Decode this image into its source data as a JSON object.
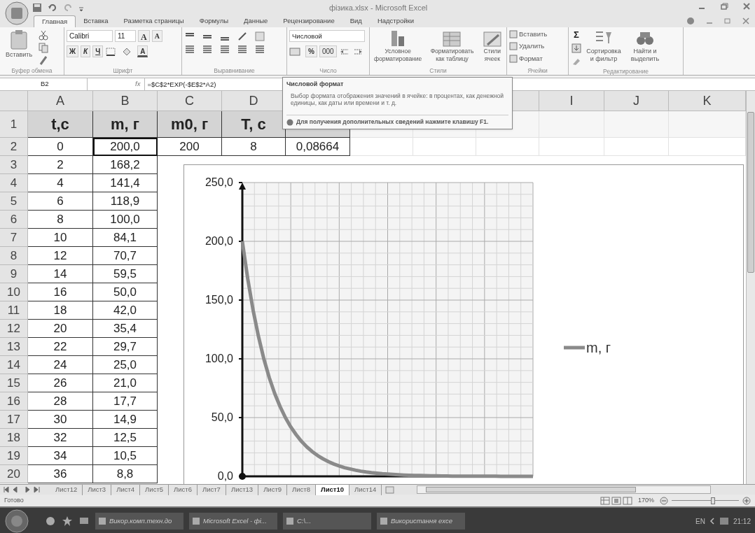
{
  "window": {
    "title": "фізика.xlsx - Microsoft Excel"
  },
  "ribbon_tabs": [
    {
      "label": "Главная",
      "selected": true
    },
    {
      "label": "Вставка",
      "selected": false
    },
    {
      "label": "Разметка страницы",
      "selected": false
    },
    {
      "label": "Формулы",
      "selected": false
    },
    {
      "label": "Данные",
      "selected": false
    },
    {
      "label": "Рецензирование",
      "selected": false
    },
    {
      "label": "Вид",
      "selected": false
    },
    {
      "label": "Надстройки",
      "selected": false
    }
  ],
  "ribbon_groups": [
    {
      "kind": "clipboard",
      "label": "Буфер обмена",
      "paste": "Вставить"
    },
    {
      "kind": "font",
      "label": "Шрифт",
      "font_name": "Calibri",
      "font_size": "11",
      "grow": "A",
      "shrink": "A",
      "bold": "Ж",
      "italic": "К",
      "underline": "Ч",
      "font_color_button": "A"
    },
    {
      "kind": "alignment",
      "label": "Выравнивание"
    },
    {
      "kind": "number",
      "label": "Число",
      "format": "Числовой",
      "percent": "%",
      "thousands": "000"
    },
    {
      "kind": "styles",
      "label": "Стили",
      "buttons": [
        "Условное форматирование",
        "Форматировать как таблицу",
        "Стили ячеек"
      ]
    },
    {
      "kind": "cells",
      "label": "Ячейки",
      "buttons": [
        "Вставить",
        "Удалить",
        "Формат"
      ]
    },
    {
      "kind": "editing",
      "label": "Редактирование",
      "sigma": "Σ",
      "buttons": [
        "Сортировка и фильтр",
        "Найти и выделить"
      ]
    }
  ],
  "formula_bar": {
    "name_box": "B2",
    "fx": "fx",
    "formula": "=$C$2*EXP(-$E$2*A2)"
  },
  "tooltip": {
    "title": "Числовой формат",
    "body": "Выбор формата отображения значений в ячейке: в процентах, как денежной единицы, как даты или времени и т. д.",
    "help": "Для получения дополнительных сведений нажмите клавишу F1."
  },
  "column_headers_left": [
    "A",
    "B",
    "C",
    "D"
  ],
  "column_headers_right": [
    "I",
    "J",
    "K"
  ],
  "rows": [
    {
      "number": "1",
      "header": true,
      "cells": [
        {
          "text": "t,c",
          "selected": false
        },
        {
          "text": "m, г",
          "selected": false
        },
        {
          "text": "m0, г",
          "selected": false
        },
        {
          "text": "T, c",
          "selected": false
        },
        {
          "text": "",
          "selected": false
        }
      ]
    },
    {
      "number": "2",
      "cells": [
        {
          "text": "0",
          "selected": false
        },
        {
          "text": "200,0",
          "selected": true
        },
        {
          "text": "200",
          "selected": false
        },
        {
          "text": "8",
          "selected": false
        },
        {
          "text": "0,08664",
          "selected": false
        }
      ]
    },
    {
      "number": "3",
      "cells": [
        {
          "text": "2",
          "selected": false
        },
        {
          "text": "168,2",
          "selected": false
        }
      ]
    },
    {
      "number": "4",
      "cells": [
        {
          "text": "4",
          "selected": false
        },
        {
          "text": "141,4",
          "selected": false
        }
      ]
    },
    {
      "number": "5",
      "cells": [
        {
          "text": "6",
          "selected": false
        },
        {
          "text": "118,9",
          "selected": false
        }
      ]
    },
    {
      "number": "6",
      "cells": [
        {
          "text": "8",
          "selected": false
        },
        {
          "text": "100,0",
          "selected": false
        }
      ]
    },
    {
      "number": "7",
      "cells": [
        {
          "text": "10",
          "selected": false
        },
        {
          "text": "84,1",
          "selected": false
        }
      ]
    },
    {
      "number": "8",
      "cells": [
        {
          "text": "12",
          "selected": false
        },
        {
          "text": "70,7",
          "selected": false
        }
      ]
    },
    {
      "number": "9",
      "cells": [
        {
          "text": "14",
          "selected": false
        },
        {
          "text": "59,5",
          "selected": false
        }
      ]
    },
    {
      "number": "10",
      "cells": [
        {
          "text": "16",
          "selected": false
        },
        {
          "text": "50,0",
          "selected": false
        }
      ]
    },
    {
      "number": "11",
      "cells": [
        {
          "text": "18",
          "selected": false
        },
        {
          "text": "42,0",
          "selected": false
        }
      ]
    },
    {
      "number": "12",
      "cells": [
        {
          "text": "20",
          "selected": false
        },
        {
          "text": "35,4",
          "selected": false
        }
      ]
    },
    {
      "number": "13",
      "cells": [
        {
          "text": "22",
          "selected": false
        },
        {
          "text": "29,7",
          "selected": false
        }
      ]
    },
    {
      "number": "14",
      "cells": [
        {
          "text": "24",
          "selected": false
        },
        {
          "text": "25,0",
          "selected": false
        }
      ]
    },
    {
      "number": "15",
      "cells": [
        {
          "text": "26",
          "selected": false
        },
        {
          "text": "21,0",
          "selected": false
        }
      ]
    },
    {
      "number": "16",
      "cells": [
        {
          "text": "28",
          "selected": false
        },
        {
          "text": "17,7",
          "selected": false
        }
      ]
    },
    {
      "number": "17",
      "cells": [
        {
          "text": "30",
          "selected": false
        },
        {
          "text": "14,9",
          "selected": false
        }
      ]
    },
    {
      "number": "18",
      "cells": [
        {
          "text": "32",
          "selected": false
        },
        {
          "text": "12,5",
          "selected": false
        }
      ]
    },
    {
      "number": "19",
      "cells": [
        {
          "text": "34",
          "selected": false
        },
        {
          "text": "10,5",
          "selected": false
        }
      ]
    },
    {
      "number": "20",
      "cells": [
        {
          "text": "36",
          "selected": false
        },
        {
          "text": "8,8",
          "selected": false
        }
      ]
    }
  ],
  "chart": {
    "chart_data": {
      "type": "line",
      "grid": true,
      "categories": [
        null,
        null,
        null,
        null,
        null,
        null,
        null,
        null,
        null,
        null,
        null,
        null,
        null,
        null,
        null,
        null,
        null,
        null,
        null,
        null,
        null,
        null,
        null,
        null,
        null,
        null,
        null,
        null,
        null,
        null,
        null,
        null,
        null,
        null,
        null,
        null,
        null,
        null,
        null,
        null,
        null,
        null,
        null,
        null,
        null,
        null,
        null,
        null,
        null,
        null,
        null,
        null,
        null,
        null,
        null
      ],
      "ylim": [
        0,
        250
      ],
      "yticks": [
        {
          "value": 0,
          "label": "0,0"
        },
        {
          "value": 50,
          "label": "50,0"
        },
        {
          "value": 100,
          "label": "100,0"
        },
        {
          "value": 150,
          "label": "150,0"
        },
        {
          "value": 200,
          "label": "200,0"
        },
        {
          "value": 250,
          "label": "250,0"
        }
      ],
      "series": [
        {
          "name": "m, г",
          "color": "#8a8a8a",
          "values": [
            200,
            168.2,
            141.4,
            118.9,
            100,
            84.1,
            70.7,
            59.5,
            50,
            42,
            35.4,
            29.7,
            25,
            21,
            17.7,
            14.9,
            12.5,
            10.5,
            8.8,
            7.4,
            6.3,
            5.3,
            4.4,
            3.7,
            3.1,
            2.6,
            2.2,
            1.9,
            1.6,
            1.3,
            1.1,
            0.9,
            0.8,
            0.7,
            0.6,
            0.5,
            0.4,
            0.3,
            0.3,
            0.2,
            0.2,
            0.2,
            0.1,
            0.1,
            0.1,
            0.1,
            0.1,
            0.1,
            0,
            0,
            0,
            0,
            0,
            0,
            0
          ]
        }
      ]
    }
  },
  "sheet_tabs": [
    {
      "label": "Лист12",
      "selected": false
    },
    {
      "label": "Лист3",
      "selected": false
    },
    {
      "label": "Лист4",
      "selected": false
    },
    {
      "label": "Лист5",
      "selected": false
    },
    {
      "label": "Лист6",
      "selected": false
    },
    {
      "label": "Лист7",
      "selected": false
    },
    {
      "label": "Лист13",
      "selected": false
    },
    {
      "label": "Лист9",
      "selected": false
    },
    {
      "label": "Лист8",
      "selected": false
    },
    {
      "label": "Лист10",
      "selected": true
    },
    {
      "label": "Лист14",
      "selected": false
    }
  ],
  "status_bar": {
    "status": "Готово",
    "zoom": "170%",
    "level": 0.62
  },
  "taskbar": {
    "tasks": [
      "Викор.комп.техн.до",
      "Microsoft Excel - фі...",
      "C:\\...",
      "Використання exce"
    ],
    "language": "EN",
    "clock": "21:12"
  }
}
